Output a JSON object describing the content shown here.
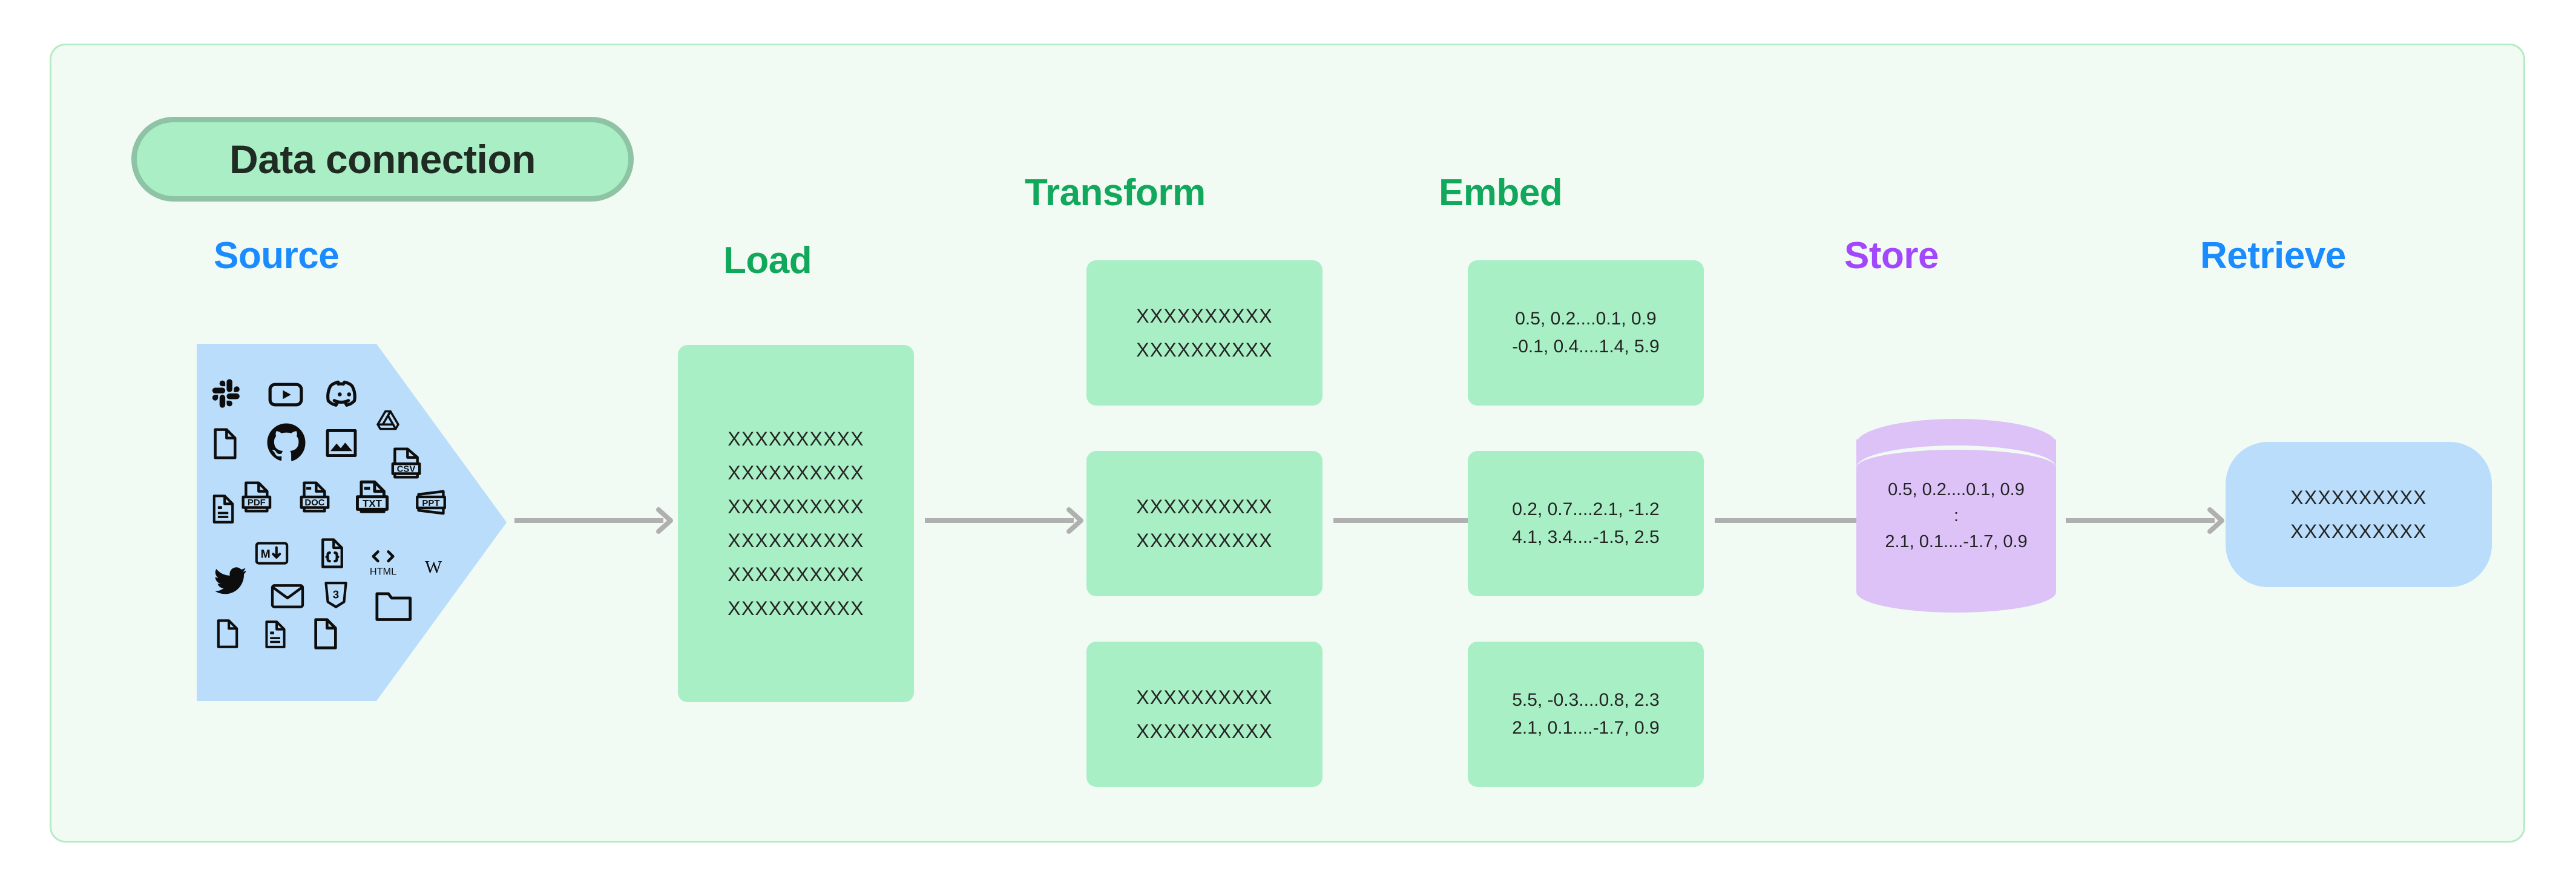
{
  "title": {
    "label": "Data connection"
  },
  "colors": {
    "canvas_bg": "#f2fbf3",
    "canvas_border": "#b6ebc5",
    "pill_fill": "#a9eec4",
    "pill_border": "#8ec4a5",
    "green_box": "#a9efc5",
    "blue_shape": "#b9ddfa",
    "purple_cylinder": "#ddc2f8",
    "arrow_gray": "#b0b0b0",
    "heading_blue": "#1a8cff",
    "heading_green": "#11a85c",
    "heading_purple": "#a347ff"
  },
  "headings": [
    {
      "id": "source",
      "label": "Source",
      "color": "#1a8cff"
    },
    {
      "id": "load",
      "label": "Load",
      "color": "#11a85c"
    },
    {
      "id": "transform",
      "label": "Transform",
      "color": "#11a85c"
    },
    {
      "id": "embed",
      "label": "Embed",
      "color": "#11a85c"
    },
    {
      "id": "store",
      "label": "Store",
      "color": "#a347ff"
    },
    {
      "id": "retrieve",
      "label": "Retrieve",
      "color": "#1a8cff"
    }
  ],
  "source": {
    "icons": [
      "slack-icon",
      "youtube-icon",
      "discord-icon",
      "file-blank-icon",
      "github-icon",
      "image-icon",
      "google-drive-icon",
      "csv-file-icon",
      "document-lines-icon",
      "pdf-file-icon",
      "doc-file-icon",
      "txt-file-icon",
      "ppt-file-icon",
      "markdown-icon",
      "json-file-icon",
      "html-icon",
      "wikipedia-icon",
      "twitter-icon",
      "email-icon",
      "css3-icon",
      "folder-icon",
      "file-blank-2-icon",
      "document-lines-2-icon",
      "file-blank-3-icon"
    ]
  },
  "load": {
    "lines": [
      "XXXXXXXXXX",
      "XXXXXXXXXX",
      "XXXXXXXXXX",
      "XXXXXXXXXX",
      "XXXXXXXXXX",
      "XXXXXXXXXX"
    ]
  },
  "transform": {
    "boxes": [
      {
        "lines": [
          "XXXXXXXXXX",
          "XXXXXXXXXX"
        ]
      },
      {
        "lines": [
          "XXXXXXXXXX",
          "XXXXXXXXXX"
        ]
      },
      {
        "lines": [
          "XXXXXXXXXX",
          "XXXXXXXXXX"
        ]
      }
    ]
  },
  "embed": {
    "boxes": [
      {
        "lines": [
          "0.5, 0.2....0.1, 0.9",
          "-0.1, 0.4....1.4, 5.9"
        ]
      },
      {
        "lines": [
          "0.2, 0.7....2.1, -1.2",
          "4.1, 3.4....-1.5, 2.5"
        ]
      },
      {
        "lines": [
          "5.5, -0.3....0.8, 2.3",
          "2.1, 0.1....-1.7, 0.9"
        ]
      }
    ]
  },
  "store": {
    "lines": [
      "0.5, 0.2....0.1, 0.9",
      ":",
      "2.1, 0.1....-1.7, 0.9"
    ]
  },
  "retrieve": {
    "lines": [
      "XXXXXXXXXX",
      "XXXXXXXXXX"
    ]
  },
  "arrows": [
    {
      "id": "source-to-load"
    },
    {
      "id": "load-to-transform"
    },
    {
      "id": "transform-to-embed"
    },
    {
      "id": "embed-to-store"
    },
    {
      "id": "store-to-retrieve"
    }
  ]
}
